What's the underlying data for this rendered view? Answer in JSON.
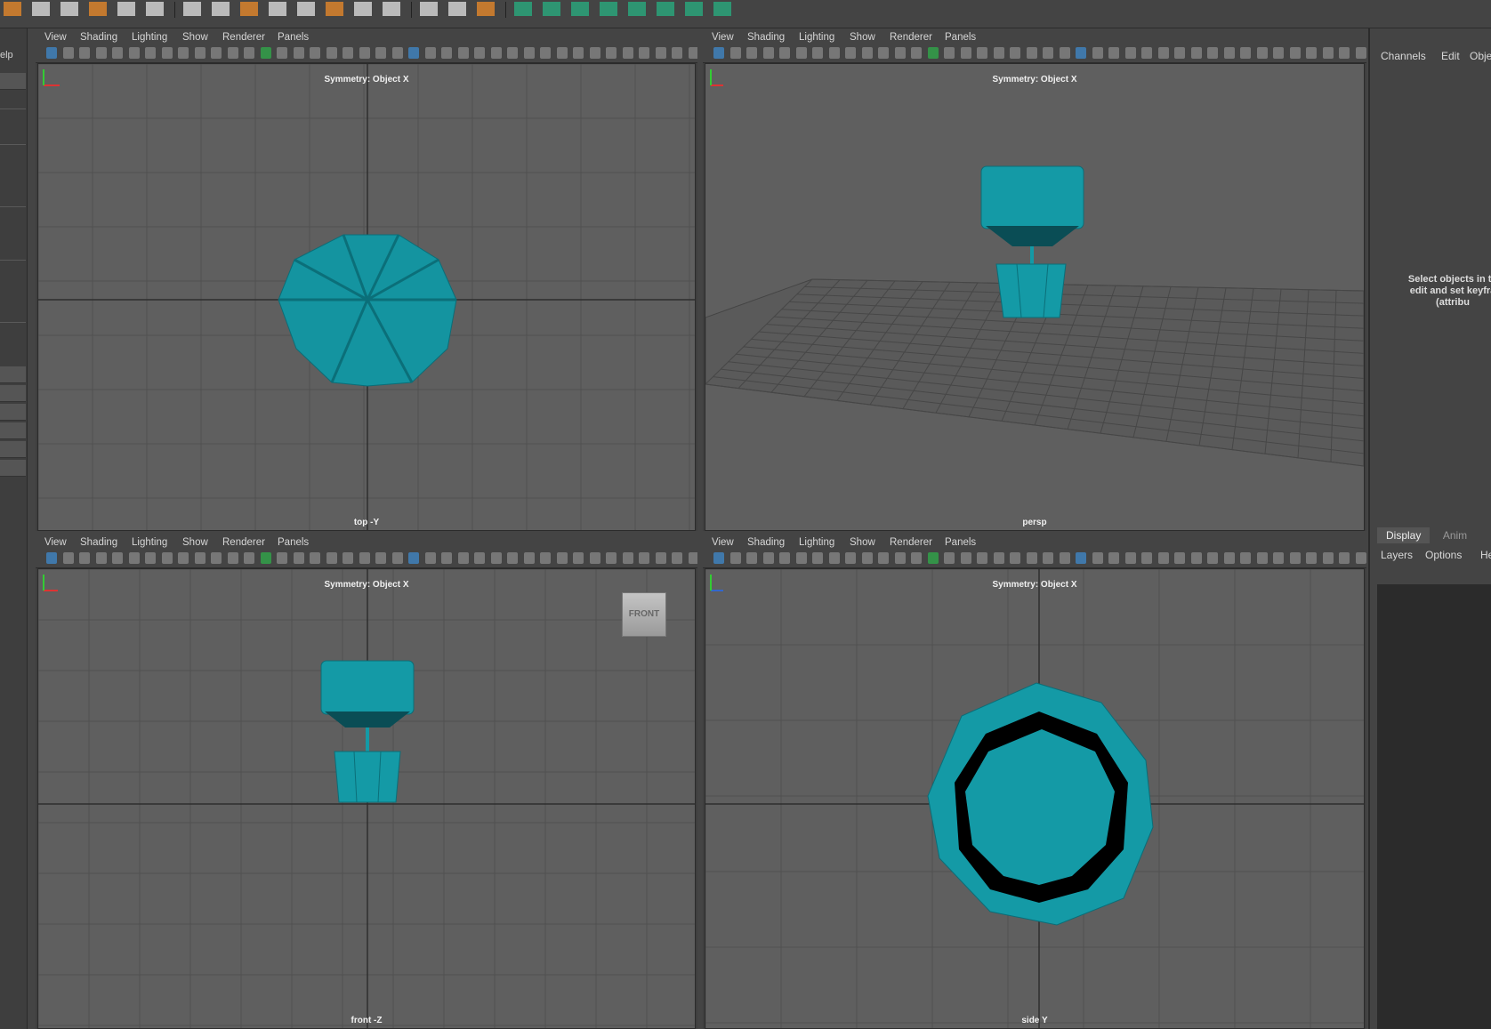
{
  "shelf": {
    "icons": [
      "cube-icon",
      "poly-icon",
      "grid-icon",
      "grid2-icon",
      "plane-icon",
      "bracket-icon",
      "sep",
      "bevel-icon",
      "extrude-icon",
      "bridge-icon",
      "append-icon",
      "merge-icon",
      "fill-icon",
      "wedge-icon",
      "split-icon",
      "sep",
      "pen-icon",
      "multicut-icon",
      "target-weld-icon",
      "sep",
      "combine-icon",
      "separate-icon",
      "boolean-icon",
      "smooth-icon",
      "reduce-icon",
      "mirror-icon",
      "retopo-icon",
      "quad-draw-icon"
    ]
  },
  "left": {
    "help_label": "elp"
  },
  "menus": [
    "View",
    "Shading",
    "Lighting",
    "Show",
    "Renderer",
    "Panels"
  ],
  "viewports": [
    {
      "id": "top",
      "symmetry": "Symmetry: Object X",
      "camera": "top -Y"
    },
    {
      "id": "persp",
      "symmetry": "Symmetry: Object X",
      "camera": "persp"
    },
    {
      "id": "front",
      "symmetry": "Symmetry: Object X",
      "camera": "front -Z",
      "view_cube": "FRONT"
    },
    {
      "id": "side",
      "symmetry": "Symmetry: Object X",
      "camera": "side Y"
    }
  ],
  "channel_box": {
    "tabs": [
      "Channels",
      "Edit",
      "Objec"
    ],
    "help_lines": [
      "Select objects in th",
      "edit and set keyfra",
      "(attribu"
    ]
  },
  "layer_editor": {
    "tabs": [
      "Display",
      "Anim"
    ],
    "menu": [
      "Layers",
      "Options",
      "Help"
    ]
  },
  "colors": {
    "mesh": "#149aa6",
    "mesh_dark": "#0b6f79",
    "viewport_bg": "#5f5f5f",
    "grid": "#4d4d4d"
  }
}
